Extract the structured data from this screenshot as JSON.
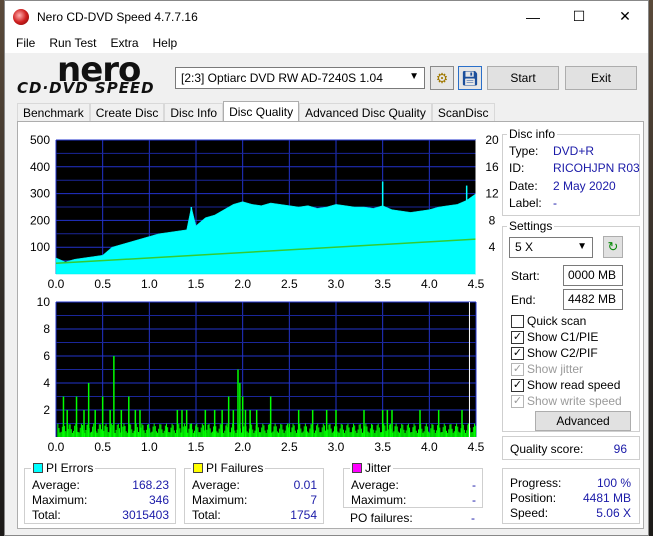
{
  "window": {
    "title": "Nero CD-DVD Speed 4.7.7.16"
  },
  "menu": [
    "File",
    "Run Test",
    "Extra",
    "Help"
  ],
  "toolbar": {
    "logo_top": "nero",
    "logo_bottom": "CD·DVD SPEED",
    "drive": "[2:3]   Optiarc DVD RW AD-7240S 1.04",
    "start": "Start",
    "exit": "Exit"
  },
  "tabs": [
    "Benchmark",
    "Create Disc",
    "Disc Info",
    "Disc Quality",
    "Advanced Disc Quality",
    "ScanDisc"
  ],
  "active_tab": "Disc Quality",
  "disc_info": {
    "title": "Disc info",
    "type_label": "Type:",
    "type": "DVD+R",
    "id_label": "ID:",
    "id": "RICOHJPN R03",
    "date_label": "Date:",
    "date": "2 May 2020",
    "label_label": "Label:",
    "label": "-"
  },
  "settings": {
    "title": "Settings",
    "speed": "5 X",
    "start_label": "Start:",
    "start": "0000 MB",
    "end_label": "End:",
    "end": "4482 MB",
    "quick_scan": "Quick scan",
    "show_c1": "Show C1/PIE",
    "show_c2": "Show C2/PIF",
    "show_jitter": "Show jitter",
    "show_read": "Show read speed",
    "show_write": "Show write speed",
    "advanced": "Advanced"
  },
  "quality": {
    "label": "Quality score:",
    "value": "96"
  },
  "progress": {
    "progress_label": "Progress:",
    "progress": "100 %",
    "position_label": "Position:",
    "position": "4481 MB",
    "speed_label": "Speed:",
    "speed": "5.06 X"
  },
  "pi_errors": {
    "title": "PI Errors",
    "color": "#00ffff",
    "avg_label": "Average:",
    "avg": "168.23",
    "max_label": "Maximum:",
    "max": "346",
    "total_label": "Total:",
    "total": "3015403"
  },
  "pi_failures": {
    "title": "PI Failures",
    "color": "#ffff00",
    "avg_label": "Average:",
    "avg": "0.01",
    "max_label": "Maximum:",
    "max": "7",
    "total_label": "Total:",
    "total": "1754"
  },
  "jitter": {
    "title": "Jitter",
    "color": "#ff00ff",
    "avg_label": "Average:",
    "avg": "-",
    "max_label": "Maximum:",
    "max": "-",
    "po_label": "PO failures:",
    "po": "-"
  },
  "chart_data": [
    {
      "type": "area",
      "name": "PI Errors",
      "x_ticks": [
        "0.0",
        "0.5",
        "1.0",
        "1.5",
        "2.0",
        "2.5",
        "3.0",
        "3.5",
        "4.0",
        "4.5"
      ],
      "y_ticks": [
        "100",
        "200",
        "300",
        "400",
        "500"
      ],
      "y2_ticks": [
        "4",
        "8",
        "12",
        "16",
        "20"
      ],
      "xlim": [
        0,
        4.5
      ],
      "ylim": [
        0,
        500
      ],
      "y2lim": [
        0,
        20
      ],
      "pi_errors": {
        "x": [
          0.0,
          0.1,
          0.2,
          0.3,
          0.4,
          0.5,
          0.6,
          0.7,
          0.8,
          0.9,
          1.0,
          1.1,
          1.2,
          1.3,
          1.4,
          1.45,
          1.5,
          1.6,
          1.7,
          1.8,
          1.9,
          2.0,
          2.1,
          2.2,
          2.3,
          2.4,
          2.5,
          2.6,
          2.7,
          2.8,
          2.9,
          3.0,
          3.1,
          3.2,
          3.3,
          3.4,
          3.5,
          3.6,
          3.7,
          3.8,
          3.9,
          4.0,
          4.1,
          4.2,
          4.3,
          4.4,
          4.5
        ],
        "y": [
          60,
          45,
          55,
          60,
          65,
          70,
          100,
          110,
          120,
          130,
          140,
          150,
          155,
          160,
          165,
          250,
          180,
          210,
          220,
          240,
          260,
          270,
          260,
          255,
          265,
          260,
          255,
          250,
          255,
          245,
          250,
          260,
          255,
          250,
          250,
          245,
          255,
          240,
          235,
          230,
          235,
          240,
          250,
          255,
          260,
          275,
          300
        ]
      },
      "read_speed": {
        "x": [
          0.0,
          4.5
        ],
        "y": [
          1.6,
          5.2
        ]
      }
    },
    {
      "type": "bar",
      "name": "PI Failures",
      "x_ticks": [
        "0.0",
        "0.5",
        "1.0",
        "1.5",
        "2.0",
        "2.5",
        "3.0",
        "3.5",
        "4.0",
        "4.5"
      ],
      "y_ticks": [
        "2",
        "4",
        "6",
        "8",
        "10"
      ],
      "xlim": [
        0,
        4.5
      ],
      "ylim": [
        0,
        10
      ],
      "x": [
        0.08,
        0.12,
        0.22,
        0.3,
        0.35,
        0.42,
        0.5,
        0.58,
        0.62,
        0.7,
        0.78,
        0.85,
        0.9,
        1.3,
        1.35,
        1.4,
        1.45,
        1.6,
        1.7,
        1.78,
        1.85,
        1.9,
        1.95,
        1.97,
        2.0,
        2.03,
        2.08,
        2.15,
        2.3,
        2.5,
        2.6,
        2.75,
        2.9,
        3.0,
        3.3,
        3.5,
        3.55,
        3.6,
        3.9,
        4.1,
        4.35,
        4.42
      ],
      "y": [
        3,
        2,
        3,
        2,
        4,
        2,
        3,
        2,
        6,
        2,
        3,
        2,
        2,
        2,
        2,
        2,
        1,
        2,
        2,
        2,
        3,
        2,
        5,
        4,
        3,
        2,
        2,
        2,
        3,
        1,
        2,
        2,
        2,
        2,
        2,
        2,
        2,
        2,
        2,
        2,
        2,
        1
      ]
    }
  ]
}
